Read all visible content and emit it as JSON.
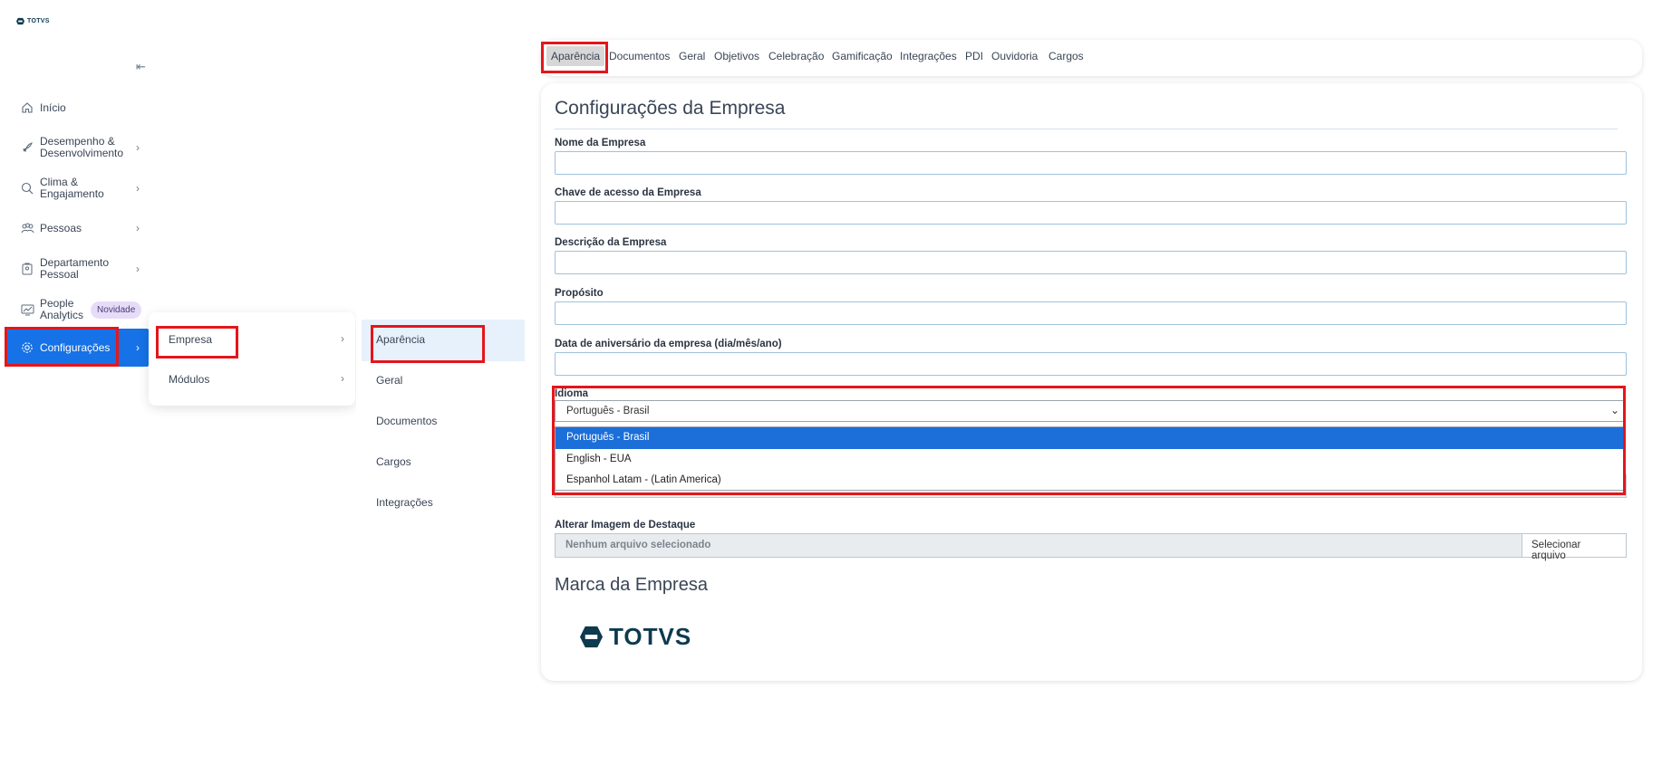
{
  "app": {
    "logo_text": "TOTVS"
  },
  "sidebar": {
    "collapse_icon": "collapse-left-icon",
    "items": [
      {
        "label": "Início",
        "icon": "home-icon"
      },
      {
        "label": "Desempenho & Desenvolvimento",
        "line1": "Desempenho &",
        "line2": "Desenvolvimento",
        "icon": "rocket-icon"
      },
      {
        "label": "Clima & Engajamento",
        "line1": "Clima &",
        "line2": "Engajamento",
        "icon": "search-chart-icon"
      },
      {
        "label": "Pessoas",
        "icon": "people-icon"
      },
      {
        "label": "Departamento Pessoal",
        "line1": "Departamento",
        "line2": "Pessoal",
        "icon": "badge-icon"
      },
      {
        "label": "People Analytics",
        "line1": "People",
        "line2": "Analytics",
        "icon": "analytics-icon",
        "badge": "Novidade"
      },
      {
        "label": "Configurações",
        "icon": "gear-icon",
        "active": true
      }
    ]
  },
  "flyout1": {
    "items": [
      {
        "label": "Empresa"
      },
      {
        "label": "Módulos"
      }
    ]
  },
  "flyout2": {
    "items": [
      {
        "label": "Aparência"
      },
      {
        "label": "Geral"
      },
      {
        "label": "Documentos"
      },
      {
        "label": "Cargos"
      },
      {
        "label": "Integrações"
      }
    ]
  },
  "tabs": [
    {
      "label": "Aparência",
      "active": true
    },
    {
      "label": "Documentos"
    },
    {
      "label": "Geral"
    },
    {
      "label": "Objetivos"
    },
    {
      "label": "Celebração"
    },
    {
      "label": "Gamificação"
    },
    {
      "label": "Integrações"
    },
    {
      "label": "PDI"
    },
    {
      "label": "Ouvidoria"
    },
    {
      "label": "Cargos"
    }
  ],
  "form": {
    "title": "Configurações da Empresa",
    "fields": [
      {
        "label": "Nome da Empresa",
        "value": ""
      },
      {
        "label": "Chave de acesso da Empresa",
        "value": ""
      },
      {
        "label": "Descrição da Empresa",
        "value": ""
      },
      {
        "label": "Propósito",
        "value": ""
      },
      {
        "label": "Data de aniversário da empresa (dia/mês/ano)",
        "value": ""
      }
    ],
    "language": {
      "label": "Idioma",
      "selected": "Português - Brasil",
      "options": [
        "Português - Brasil",
        "English - EUA",
        "Espanhol Latam - (Latin America)"
      ]
    },
    "highlight_image": {
      "label": "Alterar Imagem de Destaque",
      "file_placeholder": "Nenhum arquivo selecionado",
      "button": "Selecionar arquivo"
    },
    "brand_section": {
      "title": "Marca da Empresa",
      "logo_text": "TOTVS"
    }
  },
  "colors": {
    "active_blue": "#1672e6",
    "highlight_red": "#e4161b",
    "brand_navy": "#0e3a4f"
  }
}
